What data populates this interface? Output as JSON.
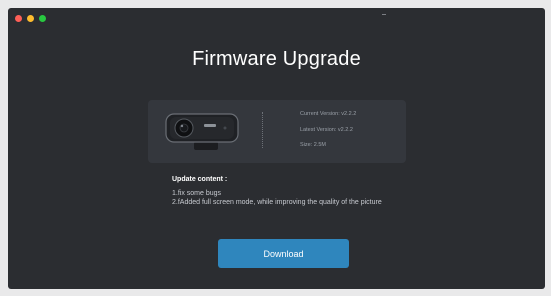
{
  "window": {
    "title": "Firmware Upgrade"
  },
  "device": {
    "current_version": "Current Version: v2.2.2",
    "latest_version": "Latest Version: v2.2.2",
    "size": "Size: 2.5M"
  },
  "update": {
    "heading": "Update content :",
    "items": [
      "1.fix some bugs",
      "2.fAdded full screen mode, while improving the quality of the picture"
    ]
  },
  "actions": {
    "download_label": "Download"
  },
  "colors": {
    "background": "#2b2d31",
    "card": "#34373d",
    "accent": "#2f86bd"
  }
}
